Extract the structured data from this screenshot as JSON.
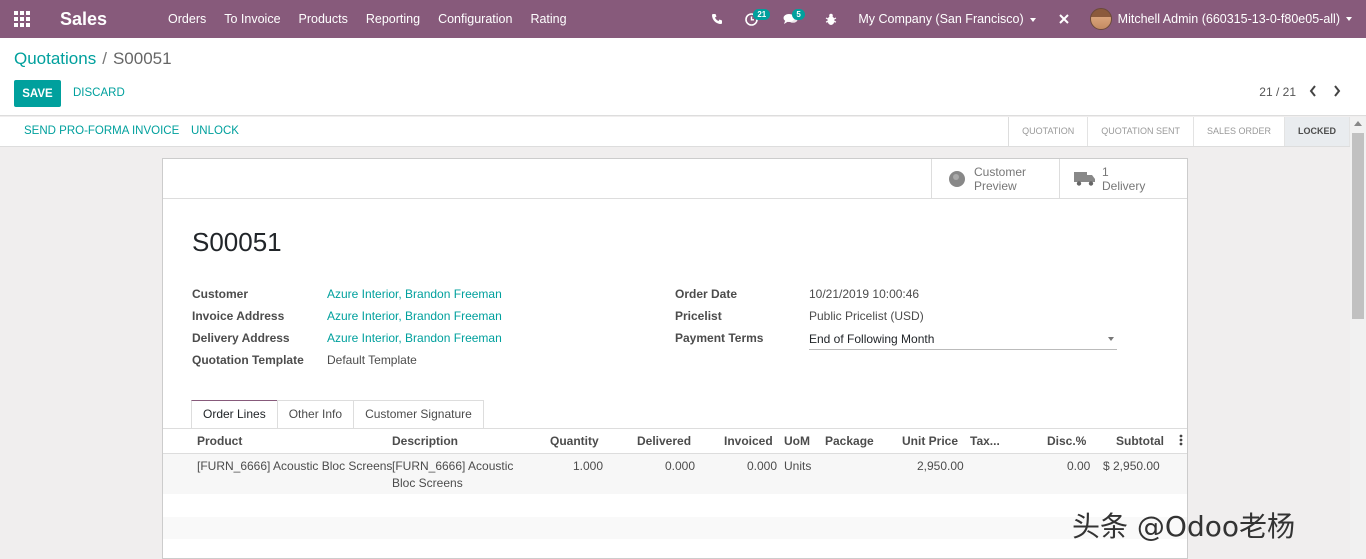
{
  "navbar": {
    "app_name": "Sales",
    "menu": [
      "Orders",
      "To Invoice",
      "Products",
      "Reporting",
      "Configuration",
      "Rating"
    ],
    "activity_count": "21",
    "message_count": "5",
    "company": "My Company (San Francisco)",
    "user": "Mitchell Admin (660315-13-0-f80e05-all)"
  },
  "breadcrumb": {
    "parent": "Quotations",
    "separator": "/",
    "current": "S00051"
  },
  "buttons": {
    "save": "SAVE",
    "discard": "DISCARD"
  },
  "pager": {
    "value": "21 / 21"
  },
  "statusbar": {
    "send_proforma": "SEND PRO-FORMA INVOICE",
    "unlock": "UNLOCK",
    "stages": [
      "QUOTATION",
      "QUOTATION SENT",
      "SALES ORDER",
      "LOCKED"
    ],
    "active_stage": "LOCKED"
  },
  "smart_buttons": {
    "preview_line1": "Customer",
    "preview_line2": "Preview",
    "delivery_count": "1",
    "delivery_label": "Delivery"
  },
  "record": {
    "name": "S00051",
    "labels": {
      "customer": "Customer",
      "invoice_address": "Invoice Address",
      "delivery_address": "Delivery Address",
      "quotation_template": "Quotation Template",
      "order_date": "Order Date",
      "pricelist": "Pricelist",
      "payment_terms": "Payment Terms"
    },
    "values": {
      "customer": "Azure Interior, Brandon Freeman",
      "invoice_address": "Azure Interior, Brandon Freeman",
      "delivery_address": "Azure Interior, Brandon Freeman",
      "quotation_template": "Default Template",
      "order_date": "10/21/2019 10:00:46",
      "pricelist": "Public Pricelist (USD)",
      "payment_terms": "End of Following Month"
    }
  },
  "tabs": [
    "Order Lines",
    "Other Info",
    "Customer Signature"
  ],
  "order_lines": {
    "columns": [
      "Product",
      "Description",
      "Quantity",
      "Delivered",
      "Invoiced",
      "UoM",
      "Package",
      "Unit Price",
      "Tax...",
      "Disc.%",
      "Subtotal"
    ],
    "rows": [
      {
        "product": "[FURN_6666] Acoustic Bloc Screens",
        "description_line1": "[FURN_6666] Acoustic",
        "description_line2": "Bloc Screens",
        "quantity": "1.000",
        "delivered": "0.000",
        "invoiced": "0.000",
        "uom": "Units",
        "package": "",
        "unit_price": "2,950.00",
        "taxes": "",
        "discount": "0.00",
        "subtotal": "$ 2,950.00"
      }
    ]
  },
  "watermark": "头条 @Odoo老杨",
  "colors": {
    "primary": "#875a7b",
    "accent": "#00a09d"
  }
}
